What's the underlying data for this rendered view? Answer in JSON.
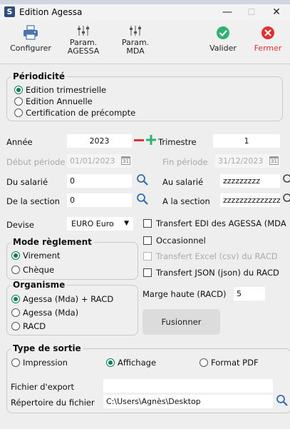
{
  "window": {
    "title": "Edition Agessa",
    "app_icon_letter": "S"
  },
  "toolbar": {
    "configurer": "Configurer",
    "param_agessa_1": "Param.",
    "param_agessa_2": "AGESSA",
    "param_mda_1": "Param.",
    "param_mda_2": "MDA",
    "valider": "Valider",
    "fermer": "Fermer",
    "valider_color": "#2db36f",
    "fermer_color": "#e03030"
  },
  "periodicite": {
    "title": "Périodicité",
    "options": [
      "Edition trimestrielle",
      "Edition Annuelle",
      "Certification de précompte"
    ],
    "selected": 0
  },
  "fields": {
    "annee_label": "Année",
    "annee_value": "2023",
    "trimestre_label": "Trimestre",
    "trimestre_value": "1",
    "debut_label": "Début période",
    "debut_value": "01/01/2023",
    "fin_label": "Fin période",
    "fin_value": "31/12/2023",
    "du_salarie_label": "Du salarié",
    "du_salarie_value": "0",
    "au_salarie_label": "Au salarié",
    "au_salarie_value": "zzzzzzzzz",
    "de_section_label": "De la section",
    "de_section_value": "0",
    "a_section_label": "A la section",
    "a_section_value": "zzzzzzzzzzzzzz",
    "devise_label": "Devise",
    "devise_value": "EURO Euro"
  },
  "mode_reglement": {
    "title": "Mode règlement",
    "options": [
      "Virement",
      "Chèque"
    ],
    "selected": 0
  },
  "organisme": {
    "title": "Organisme",
    "options": [
      "Agessa (Mda) + RACD",
      "Agessa (Mda)",
      "RACD"
    ],
    "selected": 0
  },
  "checks": {
    "transfert_edi": "Transfert EDI des AGESSA (MDA",
    "occasionnel": "Occasionnel",
    "transfert_excel": "Transfert Excel (csv) du RACD",
    "transfert_json": "Transfert JSON (json) du RACD"
  },
  "marge": {
    "label": "Marge haute (RACD)",
    "value": "5"
  },
  "fusionner": "Fusionner",
  "sortie": {
    "title": "Type de sortie",
    "options": [
      "Impression",
      "Affichage",
      "Format PDF"
    ],
    "selected": 1,
    "fichier_export_label": "Fichier d'export",
    "fichier_export_value": "",
    "repertoire_label": "Répertoire du fichier",
    "repertoire_value": "C:\\Users\\Agnès\\Desktop"
  },
  "calendar_icon_text": "31"
}
